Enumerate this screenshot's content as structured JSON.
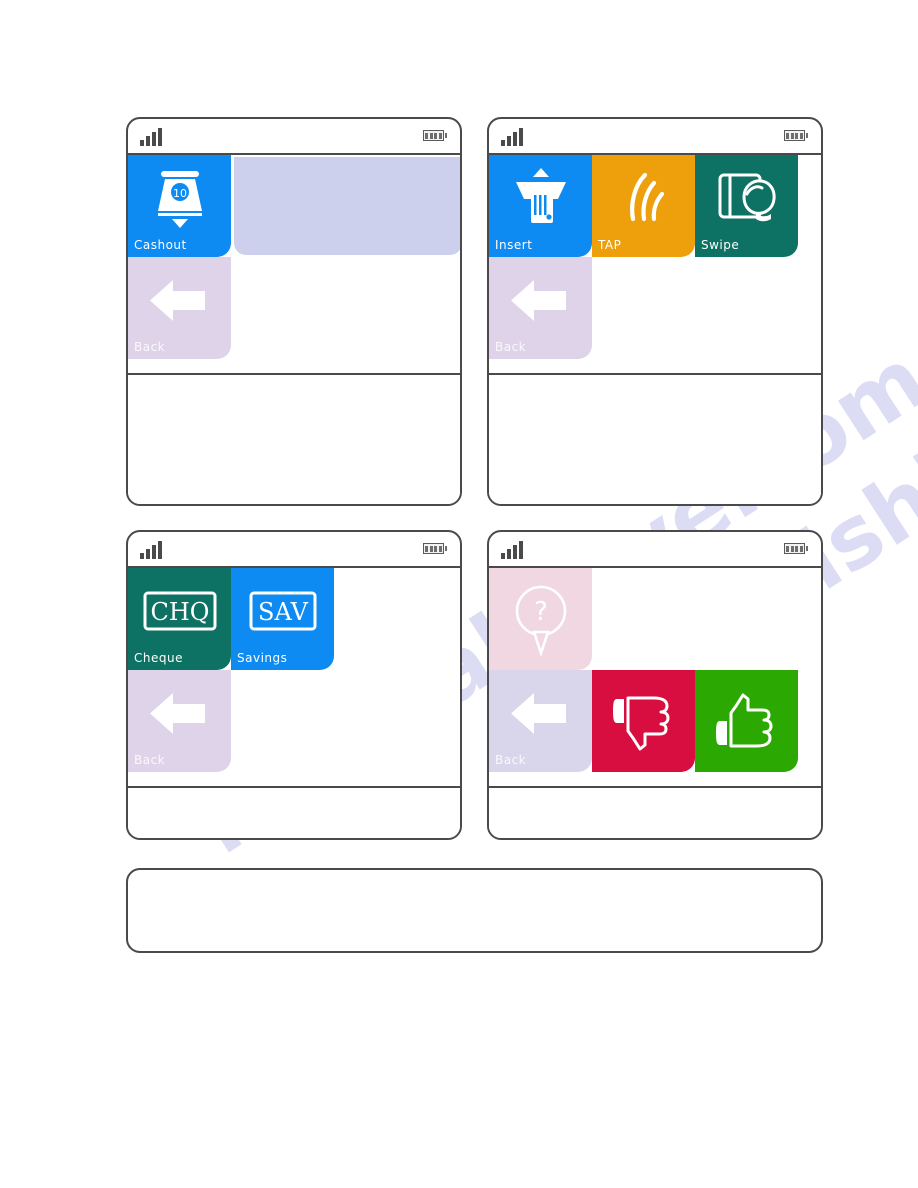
{
  "document": {
    "background": "#ffffff",
    "watermark": [
      "manualshive.com",
      "manualshive.com"
    ]
  },
  "palette": {
    "blue": "#0d8bf2",
    "amber": "#eda00c",
    "teal": "#0d7263",
    "back_lavender": "#ded3e8",
    "placeholder_blue": "#ccd0ec",
    "help_pink": "#f0d7e2",
    "back_pale": "#d9d5ea",
    "crimson": "#d80d40",
    "green": "#2ca802",
    "frame": "#4a4a4a",
    "icon_white": "#ffffff"
  },
  "panels": [
    {
      "id": "panel-cashout",
      "status": {
        "signal_icon": "signal-bars-icon",
        "signal_bars": 4,
        "battery_icon": "battery-icon",
        "battery_segments": 4
      },
      "tiles": [
        {
          "name": "cashout-tile",
          "label": "Cashout",
          "icon": "cash-dispenser-icon",
          "color": "#0d8bf2",
          "interactable": true
        },
        {
          "name": "amount-placeholder",
          "label": "",
          "icon": "placeholder-block",
          "color": "#ccd0ec",
          "interactable": false
        },
        {
          "name": "back-tile",
          "label": "Back",
          "icon": "back-arrow-icon",
          "color": "#ded3e8",
          "interactable": true
        }
      ]
    },
    {
      "id": "panel-card-entry",
      "status": {
        "signal_icon": "signal-bars-icon",
        "signal_bars": 4,
        "battery_icon": "battery-icon",
        "battery_segments": 4
      },
      "tiles": [
        {
          "name": "insert-tile",
          "label": "Insert",
          "icon": "card-insert-icon",
          "color": "#0d8bf2",
          "interactable": true
        },
        {
          "name": "tap-tile",
          "label": "TAP",
          "icon": "contactless-waves-icon",
          "color": "#eda00c",
          "interactable": true
        },
        {
          "name": "swipe-tile",
          "label": "Swipe",
          "icon": "card-swipe-hand-icon",
          "color": "#0d7263",
          "interactable": true
        },
        {
          "name": "back-tile",
          "label": "Back",
          "icon": "back-arrow-icon",
          "color": "#ded3e8",
          "interactable": true
        }
      ]
    },
    {
      "id": "panel-account-type",
      "status": {
        "signal_icon": "signal-bars-icon",
        "signal_bars": 4,
        "battery_icon": "battery-icon",
        "battery_segments": 4
      },
      "tiles": [
        {
          "name": "cheque-tile",
          "label": "Cheque",
          "icon": "chq-badge-icon",
          "badge": "CHQ",
          "color": "#0d7263",
          "interactable": true
        },
        {
          "name": "savings-tile",
          "label": "Savings",
          "icon": "sav-badge-icon",
          "badge": "SAV",
          "color": "#0d8bf2",
          "interactable": true
        },
        {
          "name": "back-tile",
          "label": "Back",
          "icon": "back-arrow-icon",
          "color": "#ded3e8",
          "interactable": true
        }
      ]
    },
    {
      "id": "panel-confirm",
      "status": {
        "signal_icon": "signal-bars-icon",
        "signal_bars": 4,
        "battery_icon": "battery-icon",
        "battery_segments": 4
      },
      "tiles": [
        {
          "name": "help-tile",
          "label": "",
          "icon": "question-bubble-icon",
          "badge": "?",
          "color": "#f0d7e2",
          "interactable": true
        },
        {
          "name": "back-tile",
          "label": "Back",
          "icon": "back-arrow-icon",
          "color": "#d9d5ea",
          "interactable": true
        },
        {
          "name": "reject-tile",
          "label": "",
          "icon": "thumbs-down-icon",
          "color": "#d80d40",
          "interactable": true
        },
        {
          "name": "accept-tile",
          "label": "",
          "icon": "thumbs-up-icon",
          "color": "#2ca802",
          "interactable": true
        }
      ]
    }
  ],
  "bottom_strip": {
    "name": "bottom-blank-strip",
    "label": ""
  }
}
